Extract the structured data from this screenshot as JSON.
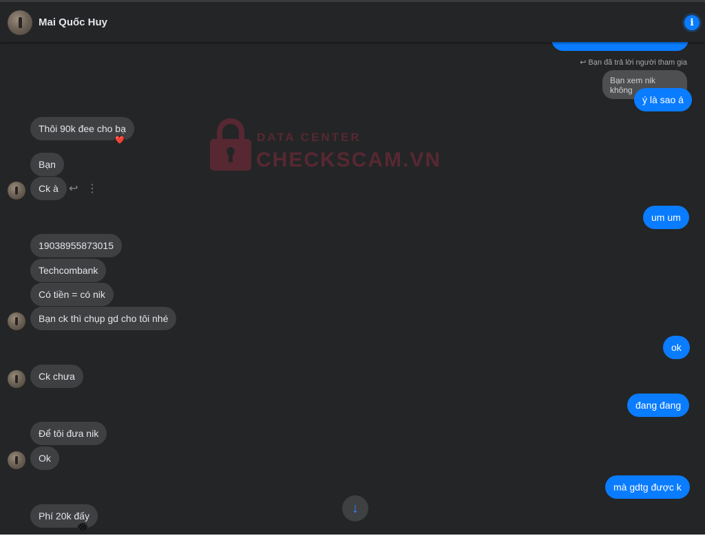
{
  "header": {
    "contact_name": "Mai Quốc Huy",
    "info_icon": "info-icon",
    "info_glyph": "i"
  },
  "watermark": {
    "line1": "DATA CENTER",
    "line2": "CHECKSCAM.VN",
    "color": "#8b2c3e"
  },
  "reply_context": {
    "note": "Bạn đã trả lời người tham gia",
    "quoted_text": "Bạn xem nik không"
  },
  "messages": [
    {
      "from": "me",
      "text": "ý là sao á"
    },
    {
      "from": "them",
      "text": "Thôi 90k đee cho bạ",
      "reaction": "❤️"
    },
    {
      "from": "them",
      "text": "Bạn"
    },
    {
      "from": "them",
      "text": "Ck à"
    },
    {
      "from": "me",
      "text": "um um"
    },
    {
      "from": "them",
      "text": "19038955873015"
    },
    {
      "from": "them",
      "text": "Techcombank"
    },
    {
      "from": "them",
      "text": "Có tiền = có nik"
    },
    {
      "from": "them",
      "text": "Bạn ck thì chụp gd cho tôi nhé"
    },
    {
      "from": "me",
      "text": "ok"
    },
    {
      "from": "them",
      "text": "Ck chưa"
    },
    {
      "from": "me",
      "text": "đang đang"
    },
    {
      "from": "them",
      "text": "Để tôi đưa nik"
    },
    {
      "from": "them",
      "text": "Ok"
    },
    {
      "from": "me",
      "text": "mà gdtg được k"
    },
    {
      "from": "them",
      "text": "Phí 20k đấy",
      "reaction": "😢"
    }
  ],
  "hover_actions": {
    "reply_icon": "reply-icon",
    "reply_glyph": "↩",
    "more_icon": "more-options-icon",
    "more_glyph": "⋮"
  },
  "scroll_button": {
    "icon": "arrow-down-icon",
    "glyph": "↓"
  },
  "colors": {
    "background": "#242526",
    "incoming_bubble": "#3e4042",
    "outgoing_bubble": "#0a7cff"
  }
}
